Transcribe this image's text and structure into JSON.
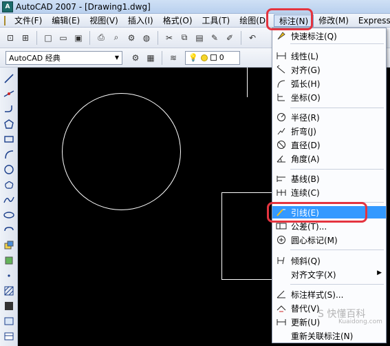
{
  "window": {
    "title": "AutoCAD 2007 - [Drawing1.dwg]",
    "app_icon_text": "A"
  },
  "menubar": {
    "items": [
      {
        "label": "文件(F)"
      },
      {
        "label": "编辑(E)"
      },
      {
        "label": "视图(V)"
      },
      {
        "label": "插入(I)"
      },
      {
        "label": "格式(O)"
      },
      {
        "label": "工具(T)"
      },
      {
        "label": "绘图(D)"
      },
      {
        "label": "标注(N)"
      },
      {
        "label": "修改(M)"
      },
      {
        "label": "Express"
      }
    ],
    "active_index": 7
  },
  "toolbar": {
    "workspace": "AutoCAD 经典",
    "layer_value": "0"
  },
  "dimension_menu": {
    "items": [
      {
        "icon": "quick-dimension-icon",
        "label": "快速标注(Q)"
      },
      {
        "icon": "linear-dimension-icon",
        "label": "线性(L)"
      },
      {
        "icon": "aligned-dimension-icon",
        "label": "对齐(G)"
      },
      {
        "icon": "arc-length-icon",
        "label": "弧长(H)"
      },
      {
        "icon": "ordinate-icon",
        "label": "坐标(O)"
      },
      {
        "icon": "radius-icon",
        "label": "半径(R)"
      },
      {
        "icon": "jogged-icon",
        "label": "折弯(J)"
      },
      {
        "icon": "diameter-icon",
        "label": "直径(D)"
      },
      {
        "icon": "angular-icon",
        "label": "角度(A)"
      },
      {
        "icon": "baseline-icon",
        "label": "基线(B)"
      },
      {
        "icon": "continue-icon",
        "label": "连续(C)"
      },
      {
        "icon": "leader-icon",
        "label": "引线(E)"
      },
      {
        "icon": "tolerance-icon",
        "label": "公差(T)..."
      },
      {
        "icon": "center-mark-icon",
        "label": "圆心标记(M)"
      },
      {
        "icon": "oblique-icon",
        "label": "倾斜(Q)"
      },
      {
        "icon": "",
        "label": "对齐文字(X)",
        "has_submenu": true
      },
      {
        "icon": "dimension-style-icon",
        "label": "标注样式(S)..."
      },
      {
        "icon": "override-icon",
        "label": "替代(V)"
      },
      {
        "icon": "update-icon",
        "label": "更新(U)"
      },
      {
        "icon": "",
        "label": "重新关联标注(N)"
      }
    ],
    "highlighted_index": 11,
    "submenu_arrow": "▶"
  },
  "watermark": {
    "text": "S 快懂百科",
    "sub": "Kuaidong.com"
  },
  "colors": {
    "canvas_bg": "#000000",
    "highlight": "#3399ff",
    "annotation_ring": "#e4343f"
  }
}
